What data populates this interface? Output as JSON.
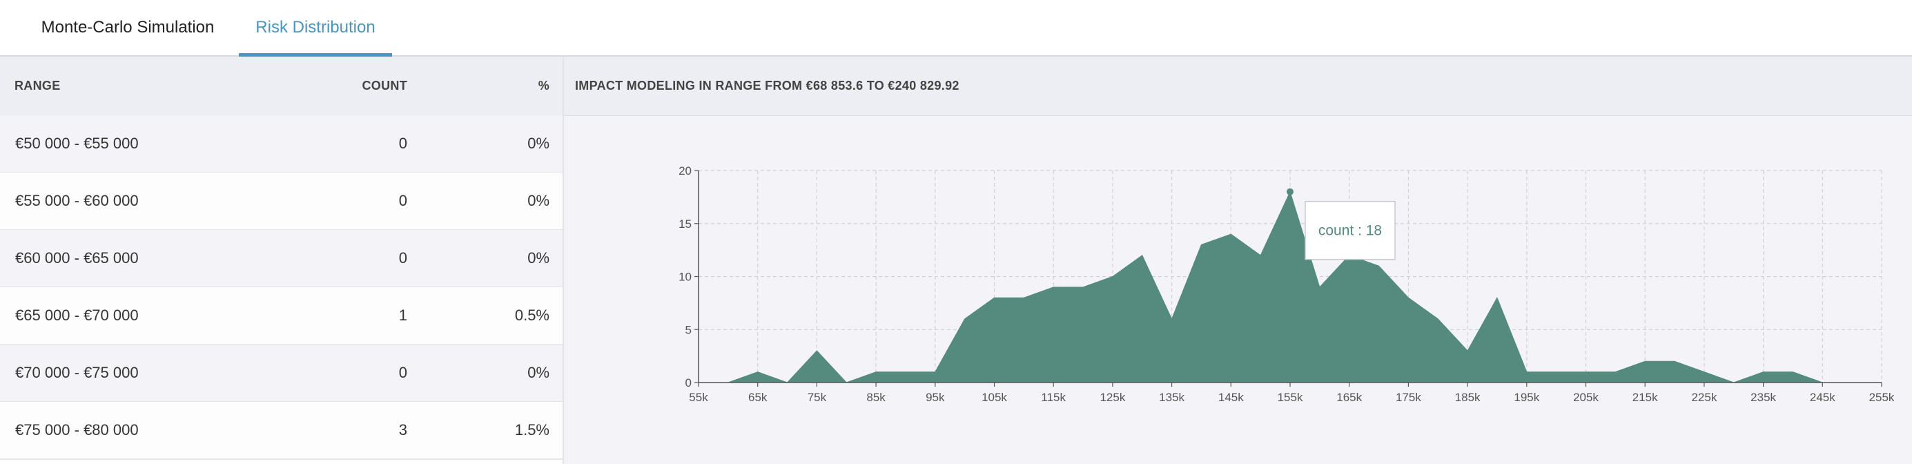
{
  "tabs": [
    {
      "label": "Monte-Carlo Simulation",
      "active": false
    },
    {
      "label": "Risk Distribution",
      "active": true
    }
  ],
  "colors": {
    "accent": "#4a95bd",
    "area": "#558a7e"
  },
  "table": {
    "headers": {
      "range": "RANGE",
      "count": "COUNT",
      "percent": "%"
    },
    "rows": [
      {
        "range": "€50 000 - €55 000",
        "count": "0",
        "percent": "0%"
      },
      {
        "range": "€55 000 - €60 000",
        "count": "0",
        "percent": "0%"
      },
      {
        "range": "€60 000 - €65 000",
        "count": "0",
        "percent": "0%"
      },
      {
        "range": "€65 000 - €70 000",
        "count": "1",
        "percent": "0.5%"
      },
      {
        "range": "€70 000 - €75 000",
        "count": "0",
        "percent": "0%"
      },
      {
        "range": "€75 000 - €80 000",
        "count": "3",
        "percent": "1.5%"
      }
    ]
  },
  "chart_title": "IMPACT MODELING IN RANGE FROM €68 853.6 TO €240 829.92",
  "tooltip": {
    "text": "count : 18",
    "x": "155k",
    "y": 18
  },
  "chart_data": {
    "type": "area",
    "title": "IMPACT MODELING IN RANGE FROM €68 853.6 TO €240 829.92",
    "xlabel": "",
    "ylabel": "",
    "ylim": [
      0,
      20
    ],
    "yticks": [
      0,
      5,
      10,
      15,
      20
    ],
    "grid": true,
    "legend": "none",
    "xticks": [
      "55k",
      "65k",
      "75k",
      "85k",
      "95k",
      "105k",
      "115k",
      "125k",
      "135k",
      "145k",
      "155k",
      "165k",
      "175k",
      "185k",
      "195k",
      "205k",
      "215k",
      "225k",
      "235k",
      "245k",
      "255k"
    ],
    "x": [
      "55k",
      "60k",
      "65k",
      "70k",
      "75k",
      "80k",
      "85k",
      "90k",
      "95k",
      "100k",
      "105k",
      "110k",
      "115k",
      "120k",
      "125k",
      "130k",
      "135k",
      "140k",
      "145k",
      "150k",
      "155k",
      "160k",
      "165k",
      "170k",
      "175k",
      "180k",
      "185k",
      "190k",
      "195k",
      "200k",
      "205k",
      "210k",
      "215k",
      "220k",
      "225k",
      "230k",
      "235k",
      "240k",
      "245k",
      "250k",
      "255k"
    ],
    "series": [
      {
        "values": [
          0,
          0,
          1,
          0,
          3,
          0,
          1,
          1,
          1,
          6,
          8,
          8,
          9,
          9,
          10,
          12,
          6,
          13,
          14,
          12,
          18,
          9,
          12,
          11,
          8,
          6,
          3,
          8,
          1,
          1,
          1,
          1,
          2,
          2,
          1,
          0,
          1,
          1,
          0,
          0,
          0
        ]
      }
    ]
  }
}
